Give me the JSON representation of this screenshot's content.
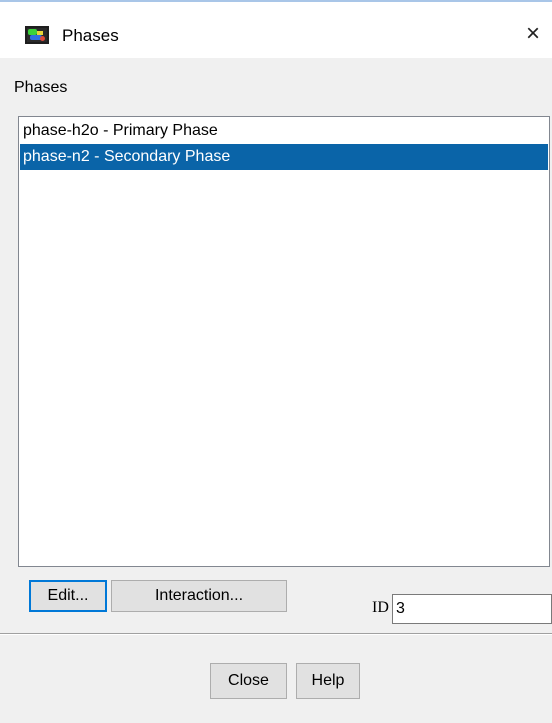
{
  "window": {
    "title": "Phases",
    "close_glyph": "×",
    "app_icon": "fluent-app-icon",
    "close_icon": "close-icon"
  },
  "phases_group": {
    "label": "Phases",
    "items": [
      {
        "label": "phase-h2o - Primary Phase",
        "selected": false
      },
      {
        "label": "phase-n2 - Secondary Phase",
        "selected": true
      }
    ]
  },
  "actions": {
    "edit_label": "Edit...",
    "interaction_label": "Interaction..."
  },
  "id_field": {
    "label": "ID",
    "value": "3"
  },
  "footer": {
    "close_label": "Close",
    "help_label": "Help"
  },
  "colors": {
    "selection": "#0a64a8",
    "default_button_border": "#0078d7",
    "dialog_background": "#f0f0f0"
  }
}
